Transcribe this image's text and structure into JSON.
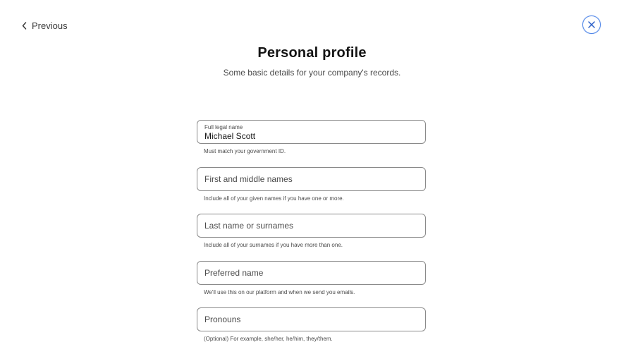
{
  "nav": {
    "previous_label": "Previous"
  },
  "header": {
    "title": "Personal profile",
    "subtitle": "Some basic details for your company's records."
  },
  "fields": [
    {
      "label": "Full legal name",
      "value": "Michael Scott",
      "help": "Must match your government ID."
    },
    {
      "placeholder": "First and middle names",
      "help": "Include all of your given names if you have one or more."
    },
    {
      "placeholder": "Last name or surnames",
      "help": "Include all of your surnames if you have more than one."
    },
    {
      "placeholder": "Preferred name",
      "help": "We'll use this on our platform and when we send you emails."
    },
    {
      "placeholder": "Pronouns",
      "help": "(Optional) For example, she/her, he/him, they/them."
    }
  ],
  "icons": {
    "previous": "chevron-left-icon",
    "close": "close-icon"
  },
  "colors": {
    "accent": "#4f86e8",
    "border": "#8a8a8a",
    "text": "#141414",
    "muted": "#4a4a4a"
  }
}
